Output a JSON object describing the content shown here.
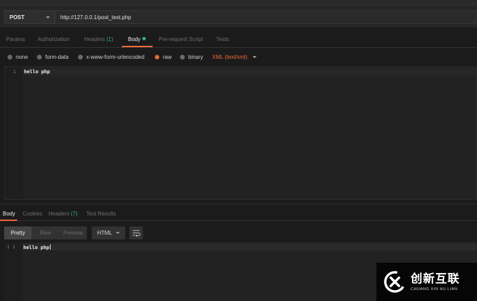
{
  "request": {
    "method": "POST",
    "url": "http://127.0.0.1/post_test.php"
  },
  "request_tabs": {
    "params": "Params",
    "authorization": "Authorization",
    "headers": "Headers",
    "headers_count": "(1)",
    "body": "Body",
    "prerequest": "Pre-request Script",
    "tests": "Tests"
  },
  "body_options": {
    "none": "none",
    "form_data": "form-data",
    "urlencoded": "x-www-form-urlencoded",
    "raw": "raw",
    "binary": "binary",
    "content_type": "XML (text/xml)",
    "selected": "raw"
  },
  "request_editor": {
    "line_number": "1",
    "content": "hello php"
  },
  "response_tabs": {
    "body": "Body",
    "cookies": "Cookies",
    "headers": "Headers",
    "headers_count": "(7)",
    "test_results": "Test Results"
  },
  "response_toolbar": {
    "pretty": "Pretty",
    "raw": "Raw",
    "preview": "Preview",
    "format": "HTML"
  },
  "response_editor": {
    "fold_marker": "i",
    "line_number": "1",
    "content": "hello php"
  },
  "watermark": {
    "chinese": "创新互联",
    "english": "CHUANG XIN HU LIAN"
  },
  "colors": {
    "accent": "#f26b3a",
    "count_green": "#31b47c",
    "background": "#1b1b1b"
  }
}
